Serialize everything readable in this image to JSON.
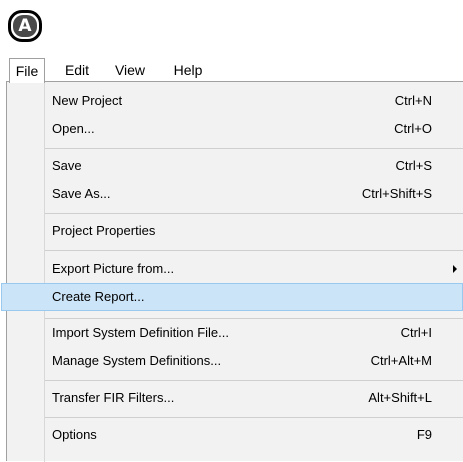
{
  "badge": {
    "letter": "A"
  },
  "menubar": {
    "items": [
      {
        "label": "File"
      },
      {
        "label": "Edit"
      },
      {
        "label": "View"
      },
      {
        "label": "Help"
      }
    ]
  },
  "file_menu": {
    "items": [
      {
        "label": "New Project",
        "shortcut": "Ctrl+N"
      },
      {
        "label": "Open...",
        "shortcut": "Ctrl+O"
      },
      {
        "label": "Save",
        "shortcut": "Ctrl+S"
      },
      {
        "label": "Save As...",
        "shortcut": "Ctrl+Shift+S"
      },
      {
        "label": "Project Properties",
        "shortcut": ""
      },
      {
        "label": "Export Picture from...",
        "shortcut": "",
        "has_submenu": true
      },
      {
        "label": "Create Report...",
        "shortcut": "",
        "highlighted": true
      },
      {
        "label": "Import System Definition File...",
        "shortcut": "Ctrl+I"
      },
      {
        "label": "Manage System Definitions...",
        "shortcut": "Ctrl+Alt+M"
      },
      {
        "label": "Transfer FIR Filters...",
        "shortcut": "Alt+Shift+L"
      },
      {
        "label": "Options",
        "shortcut": "F9"
      }
    ]
  },
  "colors": {
    "highlight_fill": "#cce4f7",
    "highlight_border": "#99c9ef",
    "menu_background": "#f2f2f2"
  }
}
